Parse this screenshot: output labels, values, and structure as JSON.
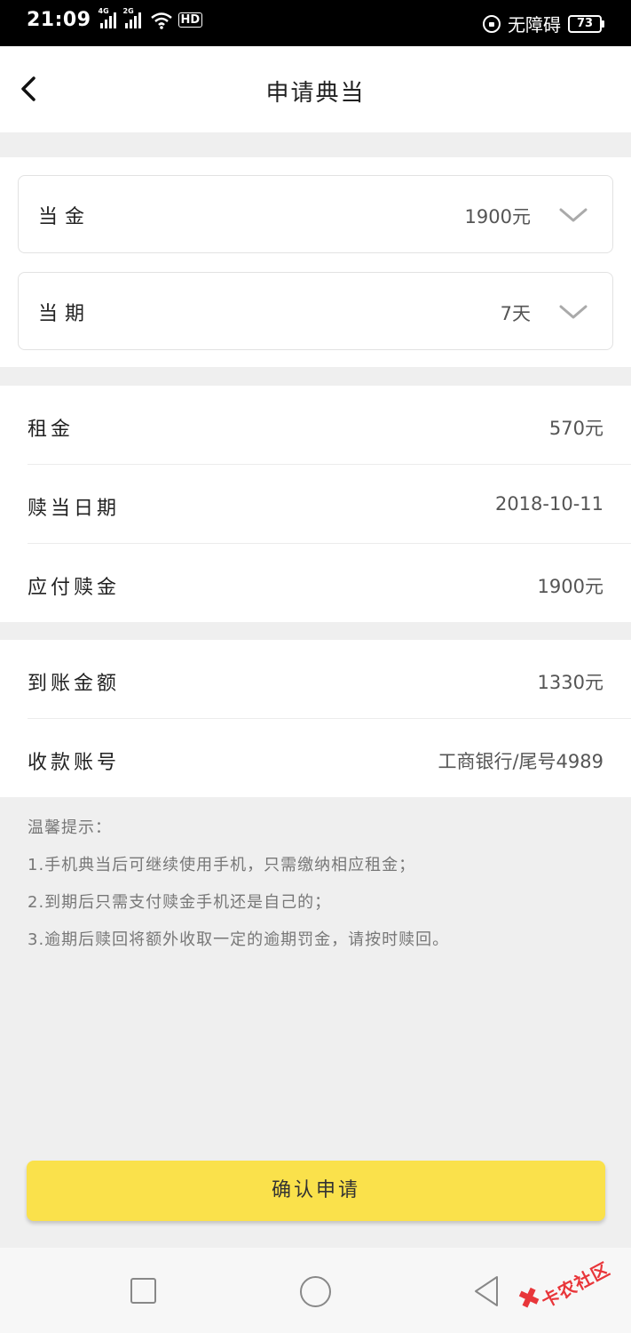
{
  "status_bar": {
    "time": "21:09",
    "signal1_tag": "4G",
    "signal2_tag": "2G",
    "hd": "HD",
    "accessibility": "无障碍",
    "battery": "73"
  },
  "nav": {
    "title": "申请典当"
  },
  "selectors": [
    {
      "label": "当金",
      "value": "1900元"
    },
    {
      "label": "当期",
      "value": "7天"
    }
  ],
  "details": [
    {
      "label": "租金",
      "value": "570元"
    },
    {
      "label": "赎当日期",
      "value": "2018-10-11"
    },
    {
      "label": "应付赎金",
      "value": "1900元"
    }
  ],
  "payout": [
    {
      "label": "到账金额",
      "value": "1330元"
    },
    {
      "label": "收款账号",
      "value": "工商银行/尾号4989"
    }
  ],
  "tips": {
    "title": "温馨提示：",
    "items": [
      "1.手机典当后可继续使用手机，只需缴纳相应租金；",
      "2.到期后只需支付赎金手机还是自己的；",
      "3.逾期后赎回将额外收取一定的逾期罚金，请按时赎回。"
    ]
  },
  "confirm_label": "确认申请",
  "watermark": "卡农社区",
  "colors": {
    "accent": "#fae14b",
    "background": "#efefef",
    "status_bar": "#000000",
    "watermark": "#e8363a"
  }
}
